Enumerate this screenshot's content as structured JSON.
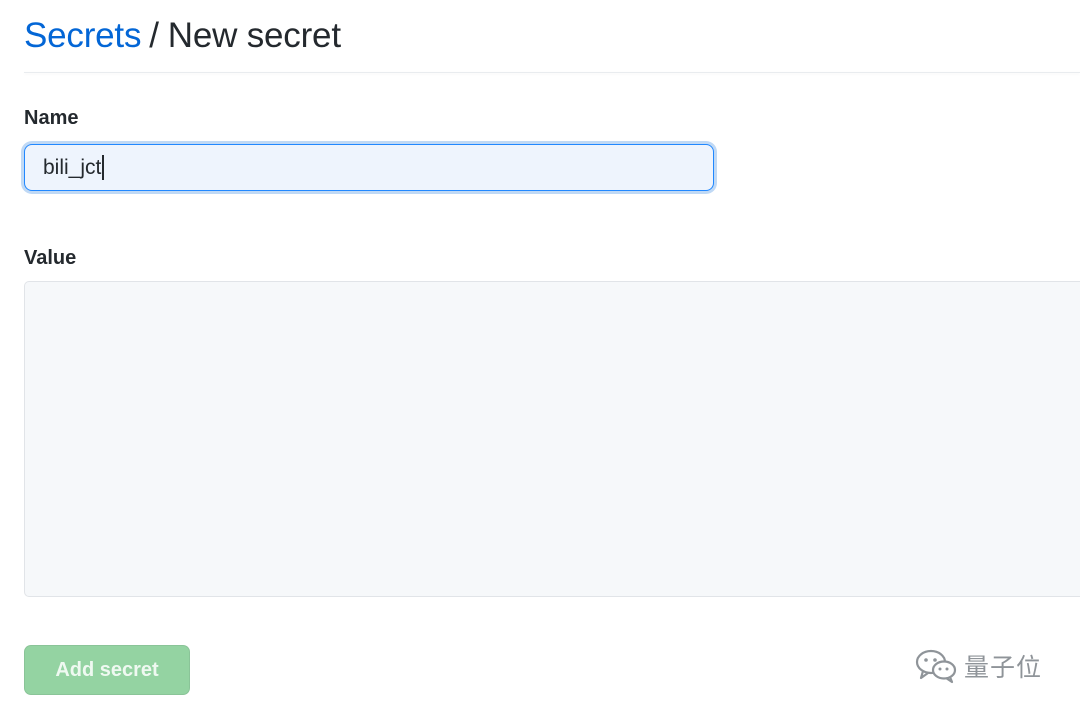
{
  "breadcrumb": {
    "parent": "Secrets",
    "separator": "/",
    "current": "New secret"
  },
  "form": {
    "name_label": "Name",
    "name_value": "bili_jct",
    "value_label": "Value",
    "value_text": "",
    "submit_label": "Add secret",
    "submit_enabled": false
  },
  "watermark": {
    "icon": "wechat-icon",
    "text": "量子位"
  },
  "colors": {
    "link": "#0366d6",
    "input_focus_border": "#2188ff",
    "button_disabled": "#94d3a2"
  }
}
